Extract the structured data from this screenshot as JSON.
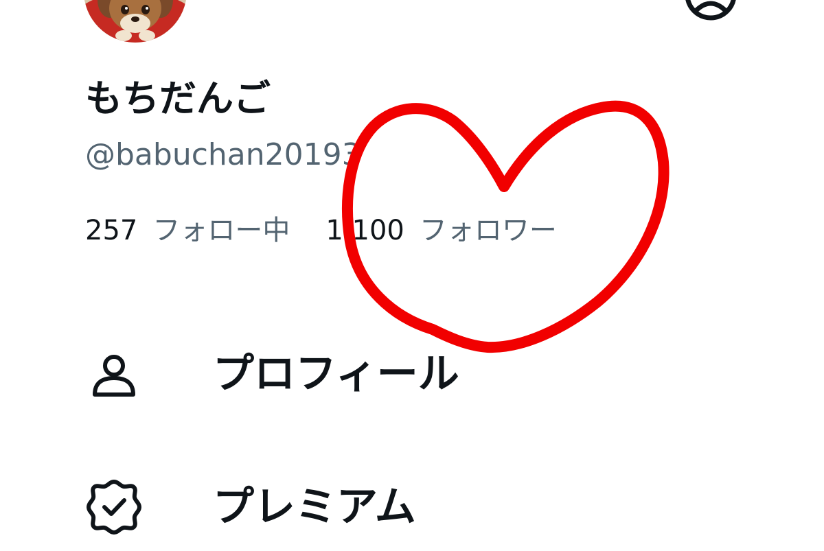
{
  "profile": {
    "display_name": "もちだんご",
    "handle": "@babuchan20193",
    "avatar_icon": "dog-avatar",
    "following_count": "257",
    "following_label": "フォロー中",
    "followers_count": "1,100",
    "followers_label": "フォロワー"
  },
  "header": {
    "account_icon": "account-switch-icon"
  },
  "menu": {
    "items": [
      {
        "label": "プロフィール",
        "icon": "person-icon"
      },
      {
        "label": "プレミアム",
        "icon": "verified-badge-icon"
      }
    ]
  },
  "annotation": {
    "shape": "heart",
    "color": "#ff0000"
  }
}
